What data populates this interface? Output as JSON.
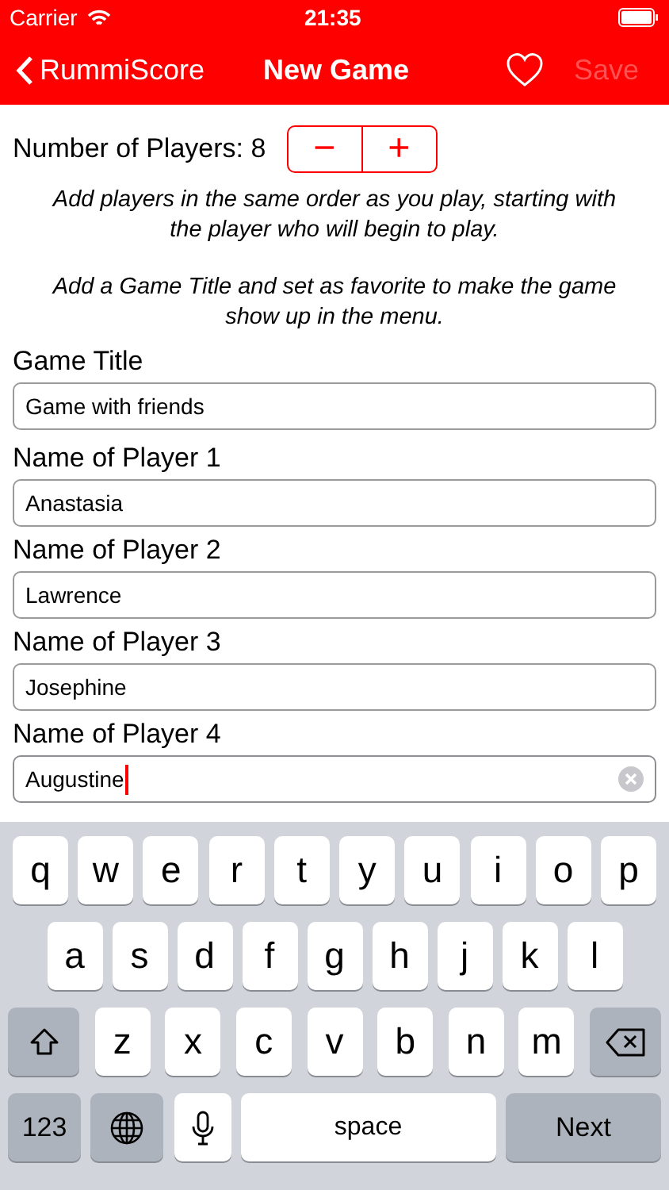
{
  "status_bar": {
    "carrier": "Carrier",
    "time": "21:35"
  },
  "nav": {
    "back": "RummiScore",
    "title": "New Game",
    "favorite": false,
    "save": {
      "label": "Save",
      "disabled": true
    }
  },
  "player_count": {
    "label": "Number of Players: 8",
    "decrement": "−",
    "increment": "+"
  },
  "hints": [
    "Add players in the same order as you play, starting with the player who will begin to play.",
    "Add a Game Title and set as favorite to make the game show up in the menu."
  ],
  "game_title": {
    "label": "Game Title",
    "value": "Game with friends",
    "focused": false
  },
  "players": [
    {
      "label": "Name of Player 1",
      "value": "Anastasia",
      "focused": false
    },
    {
      "label": "Name of Player 2",
      "value": "Lawrence",
      "focused": false
    },
    {
      "label": "Name of Player 3",
      "value": "Josephine",
      "focused": false
    },
    {
      "label": "Name of Player 4",
      "value": "Augustine",
      "focused": true
    }
  ],
  "keyboard": {
    "rows": [
      {
        "keys": [
          {
            "kind": "letter",
            "label": "q"
          },
          {
            "kind": "letter",
            "label": "w"
          },
          {
            "kind": "letter",
            "label": "e"
          },
          {
            "kind": "letter",
            "label": "r"
          },
          {
            "kind": "letter",
            "label": "t"
          },
          {
            "kind": "letter",
            "label": "y"
          },
          {
            "kind": "letter",
            "label": "u"
          },
          {
            "kind": "letter",
            "label": "i"
          },
          {
            "kind": "letter",
            "label": "o"
          },
          {
            "kind": "letter",
            "label": "p"
          }
        ]
      },
      {
        "keys": [
          {
            "kind": "letter",
            "label": "a"
          },
          {
            "kind": "letter",
            "label": "s"
          },
          {
            "kind": "letter",
            "label": "d"
          },
          {
            "kind": "letter",
            "label": "f"
          },
          {
            "kind": "letter",
            "label": "g"
          },
          {
            "kind": "letter",
            "label": "h"
          },
          {
            "kind": "letter",
            "label": "j"
          },
          {
            "kind": "letter",
            "label": "k"
          },
          {
            "kind": "letter",
            "label": "l"
          }
        ]
      },
      {
        "keys": [
          {
            "kind": "shift"
          },
          {
            "kind": "letter",
            "label": "z"
          },
          {
            "kind": "letter",
            "label": "x"
          },
          {
            "kind": "letter",
            "label": "c"
          },
          {
            "kind": "letter",
            "label": "v"
          },
          {
            "kind": "letter",
            "label": "b"
          },
          {
            "kind": "letter",
            "label": "n"
          },
          {
            "kind": "letter",
            "label": "m"
          },
          {
            "kind": "backspace"
          }
        ]
      },
      {
        "keys": [
          {
            "kind": "numbers",
            "label": "123"
          },
          {
            "kind": "globe"
          },
          {
            "kind": "mic"
          },
          {
            "kind": "space",
            "label": "space"
          },
          {
            "kind": "action",
            "label": "Next"
          }
        ]
      }
    ]
  }
}
